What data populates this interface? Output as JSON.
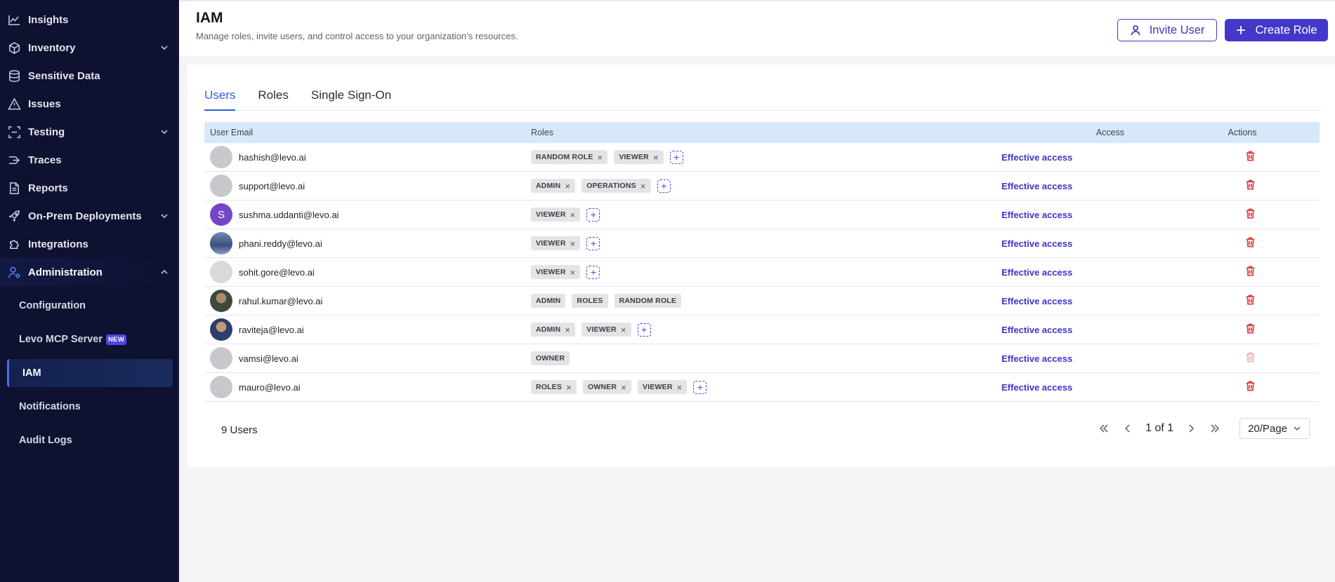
{
  "sidebar": {
    "items": [
      {
        "label": "Insights",
        "icon": "chart-line-icon",
        "expandable": false
      },
      {
        "label": "Inventory",
        "icon": "box-icon",
        "expandable": true
      },
      {
        "label": "Sensitive Data",
        "icon": "database-icon",
        "expandable": false
      },
      {
        "label": "Issues",
        "icon": "warning-icon",
        "expandable": false
      },
      {
        "label": "Testing",
        "icon": "scan-icon",
        "expandable": true
      },
      {
        "label": "Traces",
        "icon": "traces-icon",
        "expandable": false
      },
      {
        "label": "Reports",
        "icon": "report-icon",
        "expandable": false
      },
      {
        "label": "On-Prem Deployments",
        "icon": "rocket-icon",
        "expandable": true
      },
      {
        "label": "Integrations",
        "icon": "puzzle-icon",
        "expandable": false
      },
      {
        "label": "Administration",
        "icon": "user-gear-icon",
        "expandable": true
      }
    ],
    "sub_items": [
      {
        "label": "Configuration"
      },
      {
        "label": "Levo MCP Server",
        "badge": "NEW"
      },
      {
        "label": "IAM"
      },
      {
        "label": "Notifications"
      },
      {
        "label": "Audit Logs"
      }
    ]
  },
  "header": {
    "title": "IAM",
    "subtitle": "Manage roles, invite users, and control access to your organization’s resources.",
    "invite_label": "Invite User",
    "create_label": "Create Role"
  },
  "tabs": [
    "Users",
    "Roles",
    "Single Sign-On"
  ],
  "table": {
    "columns": [
      "User Email",
      "Roles",
      "Access",
      "Actions"
    ],
    "rows": [
      {
        "email": "hashish@levo.ai",
        "roles": [
          "RANDOM ROLE",
          "VIEWER"
        ]
      },
      {
        "email": "support@levo.ai",
        "roles": [
          "ADMIN",
          "OPERATIONS"
        ]
      },
      {
        "email": "sushma.uddanti@levo.ai",
        "roles": [
          "VIEWER"
        ],
        "avatar_letter": "S"
      },
      {
        "email": "phani.reddy@levo.ai",
        "roles": [
          "VIEWER"
        ]
      },
      {
        "email": "sohit.gore@levo.ai",
        "roles": [
          "VIEWER"
        ]
      },
      {
        "email": "rahul.kumar@levo.ai",
        "roles": [
          "ADMIN",
          "ROLES",
          "RANDOM ROLE"
        ]
      },
      {
        "email": "raviteja@levo.ai",
        "roles": [
          "ADMIN",
          "VIEWER"
        ]
      },
      {
        "email": "vamsi@levo.ai",
        "roles": [
          "OWNER"
        ]
      },
      {
        "email": "mauro@levo.ai",
        "roles": [
          "ROLES",
          "OWNER",
          "VIEWER"
        ]
      }
    ],
    "access_label": "Effective access"
  },
  "footer": {
    "count_label": "9 Users",
    "page_text": "1 of 1",
    "per_page": "20/Page"
  },
  "colors": {
    "sidebar_bg": "#0e1130",
    "accent": "#4338ca",
    "table_header_bg": "#d8e8fb",
    "danger": "#e23b3b"
  }
}
